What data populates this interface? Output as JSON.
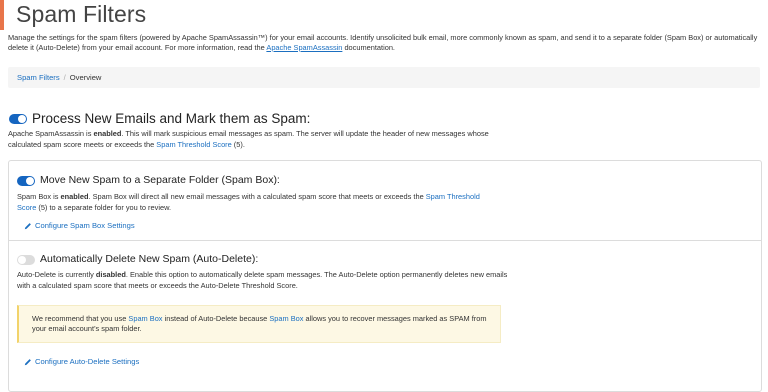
{
  "page": {
    "title": "Spam Filters",
    "intro_text": "Manage the settings for the spam filters (powered by Apache SpamAssassin™) for your email accounts. Identify unsolicited bulk email, more commonly known as spam, and send it to a separate folder (Spam Box) or automatically delete it (Auto-Delete) from your email account. For more information, read the ",
    "intro_link": "Apache SpamAssassin",
    "intro_tail": " documentation."
  },
  "breadcrumb": {
    "items": [
      "Spam Filters",
      "Overview"
    ],
    "separator": "/"
  },
  "process_spam": {
    "heading": "Process New Emails and Mark them as Spam:",
    "toggle_on": true,
    "desc_pre": "Apache SpamAssassin is ",
    "desc_status": "enabled",
    "desc_mid": ". This will mark suspicious email messages as spam. The server will update the header of new messages whose calculated spam score meets or exceeds the ",
    "desc_link": "Spam Threshold Score",
    "desc_post": " (5)."
  },
  "spam_box": {
    "heading": "Move New Spam to a Separate Folder (Spam Box):",
    "toggle_on": true,
    "desc_pre": "Spam Box is ",
    "desc_status": "enabled",
    "desc_mid": ". Spam Box will direct all new email messages with a calculated spam score that meets or exceeds the ",
    "desc_link": "Spam Threshold Score",
    "desc_post": " (5) to a separate folder for you to review.",
    "config_link": "Configure Spam Box Settings"
  },
  "auto_delete": {
    "heading": "Automatically Delete New Spam (Auto-Delete):",
    "toggle_on": false,
    "desc_pre": "Auto-Delete is currently ",
    "desc_status": "disabled",
    "desc_post": ". Enable this option to automatically delete spam messages. The Auto-Delete option permanently deletes new emails with a calculated spam score that meets or exceeds the Auto-Delete Threshold Score.",
    "notice_pre": "We recommend that you use ",
    "notice_link1": "Spam Box",
    "notice_mid": " instead of Auto-Delete because ",
    "notice_link2": "Spam Box",
    "notice_post": " allows you to recover messages marked as SPAM from your email account’s spam folder.",
    "config_link": "Configure Auto-Delete Settings"
  },
  "colors": {
    "accent": "#e8754a",
    "link": "#1b6fc0",
    "toggle_on": "#1565c0",
    "toggle_off": "#dcdcdc",
    "notice_bg": "#fdf8e4"
  },
  "icons": {
    "config_icon": "pencil-icon"
  }
}
